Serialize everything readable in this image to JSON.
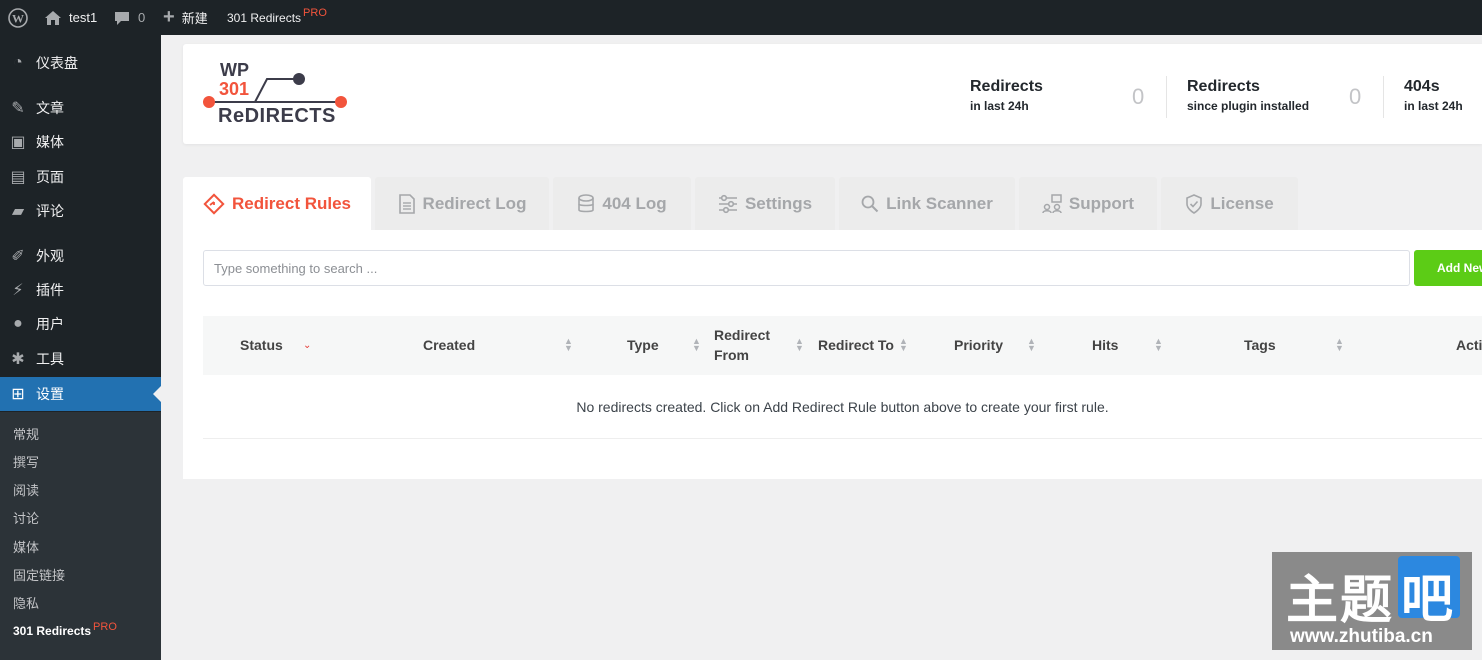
{
  "adminbar": {
    "site_name": "test1",
    "comments_count": "0",
    "new_label": "新建",
    "plugin_label": "301 Redirects",
    "plugin_badge": "PRO"
  },
  "sidebar": {
    "items": [
      {
        "label": "仪表盘",
        "icon": "dashboard-icon"
      },
      {
        "label": "文章",
        "icon": "pin-icon"
      },
      {
        "label": "媒体",
        "icon": "media-icon"
      },
      {
        "label": "页面",
        "icon": "page-icon"
      },
      {
        "label": "评论",
        "icon": "comment-icon"
      },
      {
        "label": "外观",
        "icon": "brush-icon"
      },
      {
        "label": "插件",
        "icon": "plugin-icon"
      },
      {
        "label": "用户",
        "icon": "user-icon"
      },
      {
        "label": "工具",
        "icon": "wrench-icon"
      },
      {
        "label": "设置",
        "icon": "settings-icon"
      }
    ],
    "submenu": [
      {
        "label": "常规"
      },
      {
        "label": "撰写"
      },
      {
        "label": "阅读"
      },
      {
        "label": "讨论"
      },
      {
        "label": "媒体"
      },
      {
        "label": "固定链接"
      },
      {
        "label": "隐私"
      },
      {
        "label": "301 Redirects",
        "badge": "PRO"
      }
    ]
  },
  "header": {
    "logo_wp": "WP",
    "logo_301": "301",
    "logo_redirects": "ReDIRECTS",
    "stats": [
      {
        "title": "Redirects",
        "sub": "in last 24h",
        "value": "0"
      },
      {
        "title": "Redirects",
        "sub": "since plugin installed",
        "value": "0"
      },
      {
        "title": "404s",
        "sub": "in last 24h"
      }
    ]
  },
  "tabs": [
    {
      "label": "Redirect Rules",
      "icon": "redirect-rules-icon"
    },
    {
      "label": "Redirect Log",
      "icon": "document-icon"
    },
    {
      "label": "404 Log",
      "icon": "database-icon"
    },
    {
      "label": "Settings",
      "icon": "sliders-icon"
    },
    {
      "label": "Link Scanner",
      "icon": "search-icon"
    },
    {
      "label": "Support",
      "icon": "support-icon"
    },
    {
      "label": "License",
      "icon": "shield-check-icon"
    }
  ],
  "search": {
    "placeholder": "Type something to search ..."
  },
  "add_new_label": "Add New",
  "table": {
    "columns": [
      "Status",
      "Created",
      "Type",
      "Redirect From",
      "Redirect To",
      "Priority",
      "Hits",
      "Tags",
      "Actions"
    ],
    "column_lines": {
      "redirect_from_1": "Redirect",
      "redirect_from_2": "From",
      "actions_visible": "Acti"
    },
    "empty_message": "No redirects created. Click on Add Redirect Rule button above to create your first rule."
  },
  "watermark": {
    "main": "主题",
    "box": "吧",
    "url": "www.zhutiba.cn"
  },
  "colors": {
    "adminbar_bg": "#1d2327",
    "accent_blue": "#2271b1",
    "brand_orange": "#f2543c",
    "add_button_green": "#5ccc16"
  }
}
